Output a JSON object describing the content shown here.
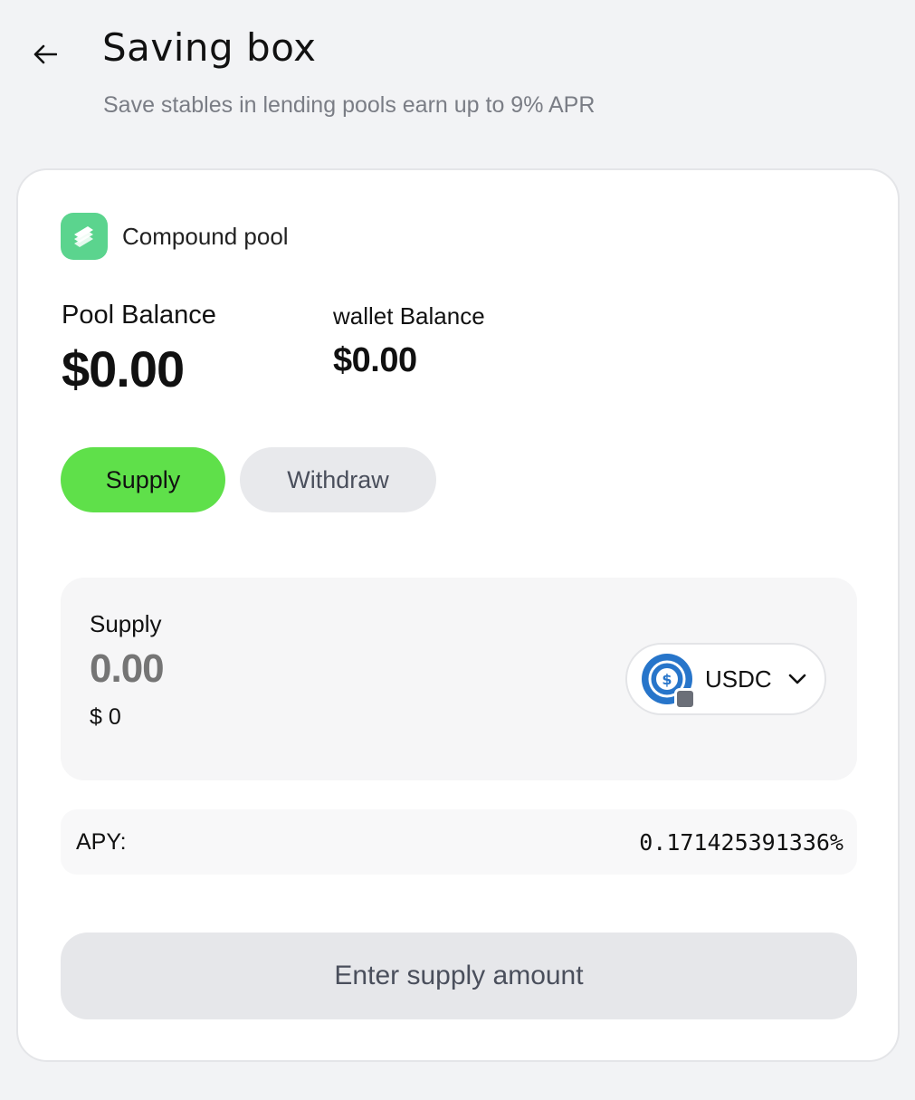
{
  "header": {
    "back_icon": "arrow-left-icon",
    "title": "Saving box",
    "subtitle": "Save stables in lending pools earn up to 9% APR"
  },
  "pool": {
    "icon": "compound-logo-icon",
    "name": "Compound pool",
    "balances": {
      "pool_label": "Pool Balance",
      "pool_value": "$0.00",
      "wallet_label": "wallet Balance",
      "wallet_value": "$0.00"
    }
  },
  "tabs": [
    {
      "label": "Supply",
      "active": true
    },
    {
      "label": "Withdraw",
      "active": false
    }
  ],
  "supply": {
    "label": "Supply",
    "amount_placeholder": "0.00",
    "usd_value": "$ 0",
    "token": {
      "symbol": "USDC",
      "icon": "usdc-icon",
      "dropdown_icon": "chevron-down-icon"
    }
  },
  "apy": {
    "label": "APY:",
    "value": "0.171425391336%"
  },
  "cta": {
    "label": "Enter supply amount",
    "enabled": false
  },
  "colors": {
    "page_bg": "#f2f3f5",
    "card_bg": "#ffffff",
    "accent_green": "#5fe04a",
    "compound_green": "#5bd48e",
    "usdc_blue": "#2775ca",
    "muted_button": "#e6e7ea"
  }
}
